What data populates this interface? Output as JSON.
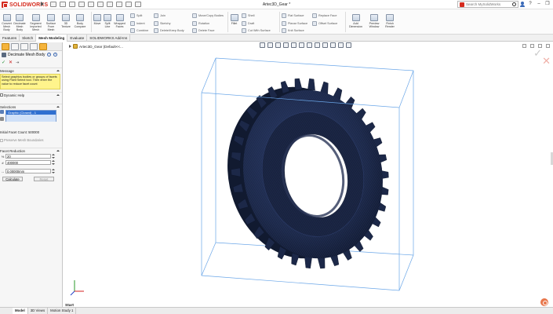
{
  "app": {
    "logo_text": "SOLIDWORKS",
    "document_title": "Artec3D_Gear *",
    "search_placeholder": "Search MySolidWorks",
    "help_label": "?",
    "minimize_label": "–",
    "restore_label": "❐",
    "close_label": "✕"
  },
  "ribbon": {
    "large_buttons": [
      {
        "label": "Convert Mesh Body"
      },
      {
        "label": "Decimate Mesh Body"
      },
      {
        "label": "Segment Imported Mesh"
      },
      {
        "label": "Surface From Mesh"
      },
      {
        "label": "3D Texture"
      },
      {
        "label": "Body Compare"
      },
      {
        "label": "Move"
      },
      {
        "label": "Split Line"
      },
      {
        "label": "Wrapped Faces"
      }
    ],
    "small_buttons_col1": [
      "Split",
      "Indent",
      "Combine"
    ],
    "small_buttons_col2": [
      "Join",
      "Sketchy",
      "Delete/Keep Body"
    ],
    "small_buttons_col3": [
      "Move/Copy Bodies",
      "Rotation",
      "Delete Face"
    ],
    "small_buttons_col4": [
      "Shell",
      "Draft",
      "Cut With Surface"
    ],
    "small_buttons_col5": [
      "Flat Surface",
      "Planar Surface",
      "Knit Surface"
    ],
    "small_buttons_col6": [
      "Replace Face",
      "Offset Surface"
    ],
    "right_buttons": [
      {
        "label": "Add Dimension"
      },
      {
        "label": "Preview Window"
      },
      {
        "label": "Finish Render"
      }
    ],
    "fillet_label": "Fillet"
  },
  "tabs": [
    "Features",
    "Sketch",
    "Mesh Modeling",
    "Evaluate",
    "SOLIDWORKS Add-Ins"
  ],
  "active_tab": "Mesh Modeling",
  "panel": {
    "title": "Decimate Mesh Body",
    "message_header": "Message",
    "message_text": "Select graphics bodies or groups of facets using Paint Select tool. Then enter the value to reduce facet count",
    "dynamic_help": "Dynamic Help",
    "selections_header": "Selections",
    "selected_item": "Graphic (Closed) - 1",
    "facet_count": "Initial Facet Count: 500000",
    "preserve_boundaries": "Preserve Mesh Boundaries",
    "facet_reduction_header": "Facet Reduction",
    "percent_value": "20",
    "count_value": "400000",
    "distance_value": "0.00000mm",
    "percent_label": "%",
    "count_label": "#",
    "distance_label": "↔",
    "calculate_button": "Calculate",
    "reset_button": "Reset"
  },
  "viewport": {
    "tree_item": "Artec3D_Gear (Default<<...",
    "start_label": "Start"
  },
  "bottom_tabs": [
    "Model",
    "3D Views",
    "Motion Study 1"
  ],
  "active_bottom_tab": "Model",
  "colors": {
    "brand_red": "#d52b1e",
    "gear_body": "#1c2848",
    "bbox_line": "#6aa6e8",
    "selection_blue": "#2f6fd0",
    "message_yellow": "#fff48c"
  }
}
